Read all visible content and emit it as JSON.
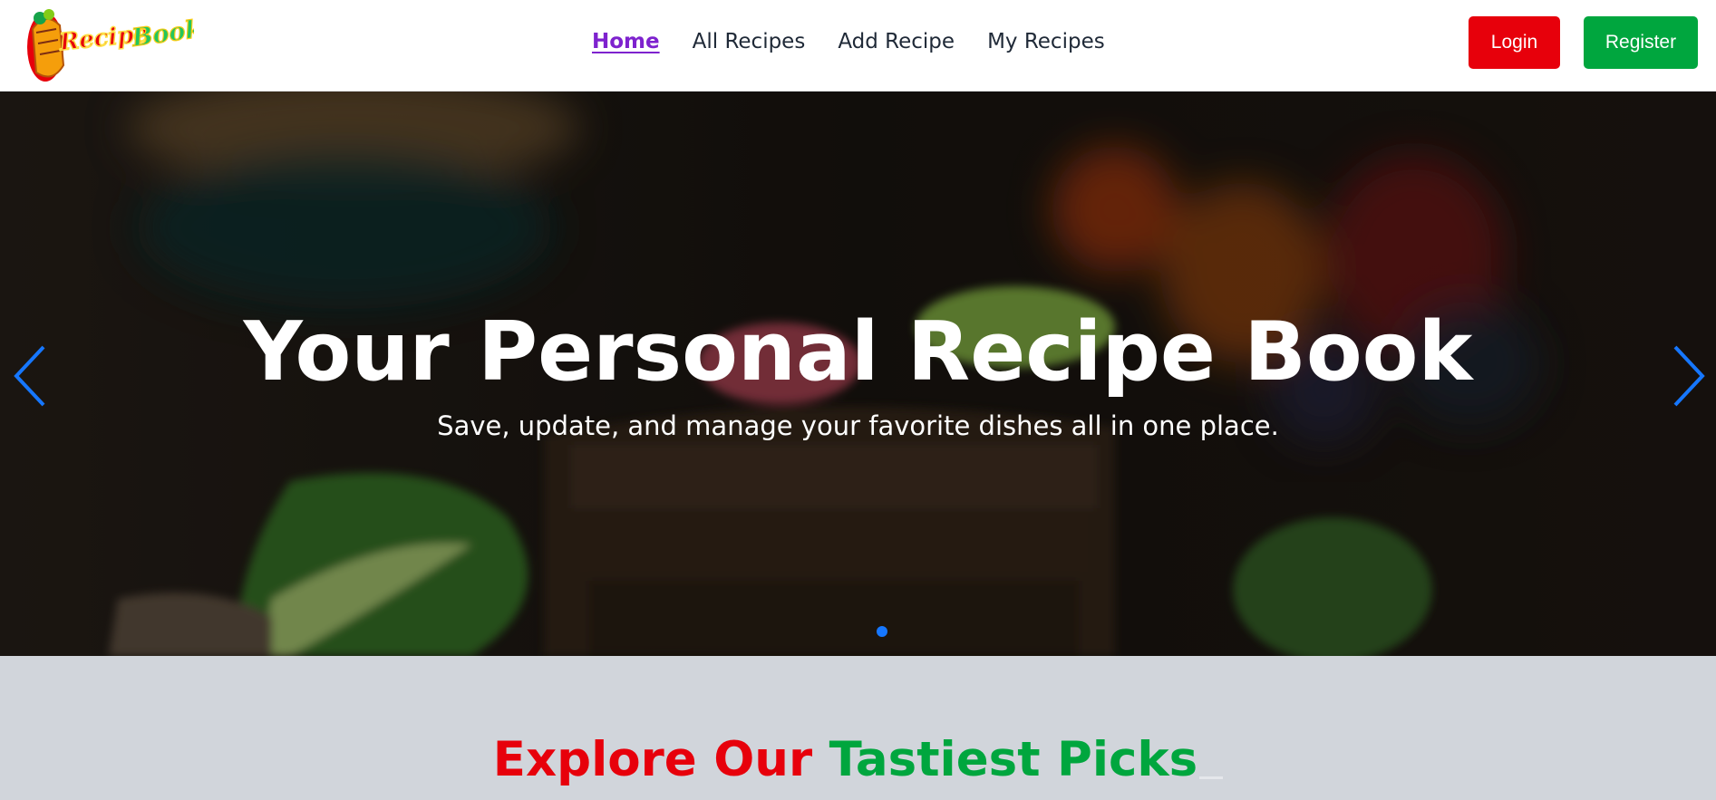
{
  "brand": {
    "logo_text": "RecipeBook"
  },
  "nav": {
    "links": [
      {
        "label": "Home",
        "active": true
      },
      {
        "label": "All Recipes"
      },
      {
        "label": "Add Recipe"
      },
      {
        "label": "My Recipes"
      }
    ]
  },
  "auth": {
    "login_label": "Login",
    "register_label": "Register"
  },
  "hero": {
    "title": "Your Personal Recipe Book",
    "subtitle": "Save, update, and manage your favorite dishes all in one place.",
    "slide_count": 1,
    "active_slide": 1
  },
  "section": {
    "title_part1": "Explore Our",
    "title_part2": "Tastiest Picks"
  },
  "colors": {
    "accent_red": "#e7000b",
    "accent_green": "#00a63e",
    "active_link": "#7e22ce",
    "carousel_accent": "#1677ff",
    "section_bg": "#d1d5db"
  }
}
